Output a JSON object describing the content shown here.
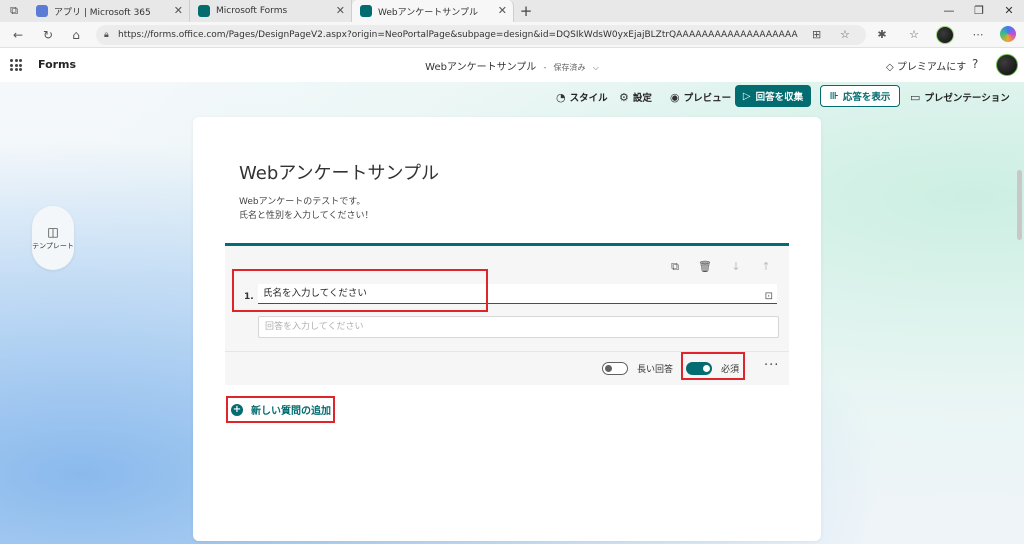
{
  "browser": {
    "tabs": [
      {
        "title": "アプリ | Microsoft 365",
        "favicon_color": "#5b7bd5"
      },
      {
        "title": "Microsoft Forms",
        "favicon_color": "#036c70"
      },
      {
        "title": "Webアンケートサンプル",
        "favicon_color": "#036c70"
      }
    ],
    "new_tab": "+",
    "url": "https://forms.office.com/Pages/DesignPageV2.aspx?origin=NeoPortalPage&subpage=design&id=DQSIkWdsW0yxEjajBLZtrQAAAAAAAAAAAAAAAAAAACQp--xUNEZB..."
  },
  "forms_header": {
    "app_name": "Forms",
    "doc_title": "Webアンケートサンプル",
    "separator": "-",
    "status": "保存済み",
    "premium_label": "プレミアムにす",
    "help": "?"
  },
  "toolbar": {
    "style_label": "スタイル",
    "settings_label": "設定",
    "preview_label": "プレビュー",
    "collect_label": "回答を収集",
    "responses_label": "応答を表示",
    "present_label": "プレゼンテーション"
  },
  "sidebar": {
    "template_label": "テンプレート"
  },
  "form": {
    "title": "Webアンケートサンプル",
    "description": [
      "Webアンケートのテストです。",
      "氏名と性別を入力してください！"
    ],
    "questions": [
      {
        "number": "1.",
        "title": "氏名を入力してください",
        "answer_placeholder": "回答を入力してください",
        "long_answer_label": "長い回答",
        "long_answer": false,
        "required_label": "必須",
        "required": true
      }
    ],
    "add_question_label": "新しい質問の追加"
  },
  "colors": {
    "accent": "#036c70",
    "annotation": "#e0242b"
  }
}
